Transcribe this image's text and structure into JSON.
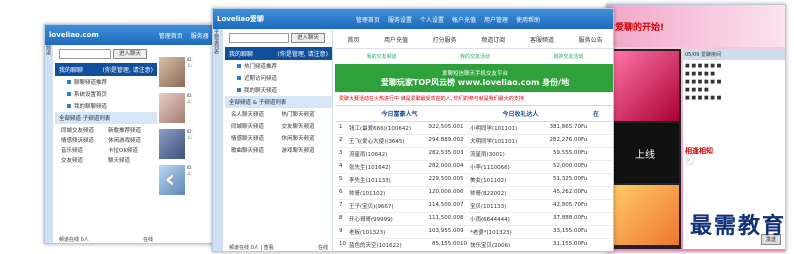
{
  "win1": {
    "logo": "loveliao.com",
    "nav": [
      "管理首页",
      "服务器"
    ],
    "search_btn": "进入聊天",
    "my_heading": "我的聊聊",
    "my_sub": "(你是管理, 请注意)",
    "items": [
      "聊聊频道推荐",
      "系统设置首页",
      "我的聊聊频道"
    ],
    "section": "全部频道 子频道列表",
    "grid": [
      "同城交友频道",
      "新歌推荐频道",
      "情感倾诉频道",
      "休闲游戏频道",
      "音乐频道",
      "卡拉OK频道",
      "交友频道",
      "聊天频道"
    ],
    "footer_left": "频道在线 0人",
    "footer_right": "在线",
    "side_tab": "频道"
  },
  "win2": {
    "logo": "Loveliao爱聊",
    "nav": [
      "管理首页",
      "服务设置",
      "个人设置",
      "帐户充值",
      "用户管理",
      "使用帮助"
    ],
    "side_title": "子频道列表",
    "search_btn": "进入聊天",
    "my_heading": "我的聊聊",
    "my_sub": "(你是管理, 请注意)",
    "items": [
      "热门频道推荐",
      "近期访问频道",
      "我的聊天频道"
    ],
    "section": "全部频道 & 子频道列表",
    "grid": [
      "名人聊天频道",
      "热门聊天频道",
      "同城聊天频道",
      "交友聊天频道",
      "情感聊天频道",
      "休闲聊天频道",
      "歌曲聊天频道",
      "游戏聊天频道"
    ],
    "footer_left": "频道在线 0人 | 查看",
    "footer_right": "在线",
    "tabs": [
      "首页",
      "用户充值",
      "打分服务",
      "频道订阅",
      "客服频道",
      "服务公告"
    ],
    "quick": [
      "我的交友频道",
      "我的交友活动",
      "我的交友活动"
    ],
    "banner_line1": "爱聊短信聊天手机交友平台",
    "banner_line2": "爱聊玩家TOP风云榜 www.loveliao.com 身份/地",
    "notice": "爱聊大赛活动在火热进行中 谁是爱聊最受欢迎的人, 你们的参与就是我们最大的支持",
    "col_heads": [
      "今日富豪人气",
      "今日收礼达人",
      "在"
    ],
    "rows": [
      [
        "1",
        "钱工(最爱666)(100642)",
        "922,505.00",
        "1",
        "小明同学(101101)",
        "381,865.70",
        "Fu"
      ],
      [
        "2",
        "王飞(爱心大使)(3645)",
        "294,889.00",
        "2",
        "大明同学(101101)",
        "282,276.00",
        "Fu"
      ],
      [
        "3",
        "流星雨(10642)",
        "282,535.00",
        "3",
        "流星雨(3001)",
        "59,555.00",
        "Fu"
      ],
      [
        "4",
        "张先生(101642)",
        "282,000.00",
        "4",
        "小李(1110066)",
        "52,000.00",
        "Fu"
      ],
      [
        "5",
        "李先生(101133)",
        "229,500.00",
        "5",
        "美女(101102)",
        "51,325.00",
        "Fu"
      ],
      [
        "6",
        "帅哥(101102)",
        "120,000.00",
        "6",
        "帅哥(822002)",
        "45,262.00",
        "Fu"
      ],
      [
        "7",
        "王子(宝贝)(9667)",
        "114,500.00",
        "7",
        "宝贝(101133)",
        "42,805.70",
        "Fu"
      ],
      [
        "8",
        "开心哥哥(99999)",
        "111,500.00",
        "8",
        "小雨(6644444)",
        "37,888.00",
        "Fu"
      ],
      [
        "9",
        "老板(101323)",
        "103,955.00",
        "9",
        "*老婆*(101323)",
        "33,155.00",
        "Fu"
      ],
      [
        "10",
        "蓝色的天空(101622)",
        "85,155.00",
        "10",
        "快乐宝贝(2006)",
        "31,155.00",
        "Fu"
      ]
    ]
  },
  "win3": {
    "top_text": "爱聊的开始!",
    "title": "05/09  爱聊房间",
    "big1": "上线",
    "big2": "相逢相知",
    "footer_btn": "发送"
  },
  "watermark": "最需教育"
}
